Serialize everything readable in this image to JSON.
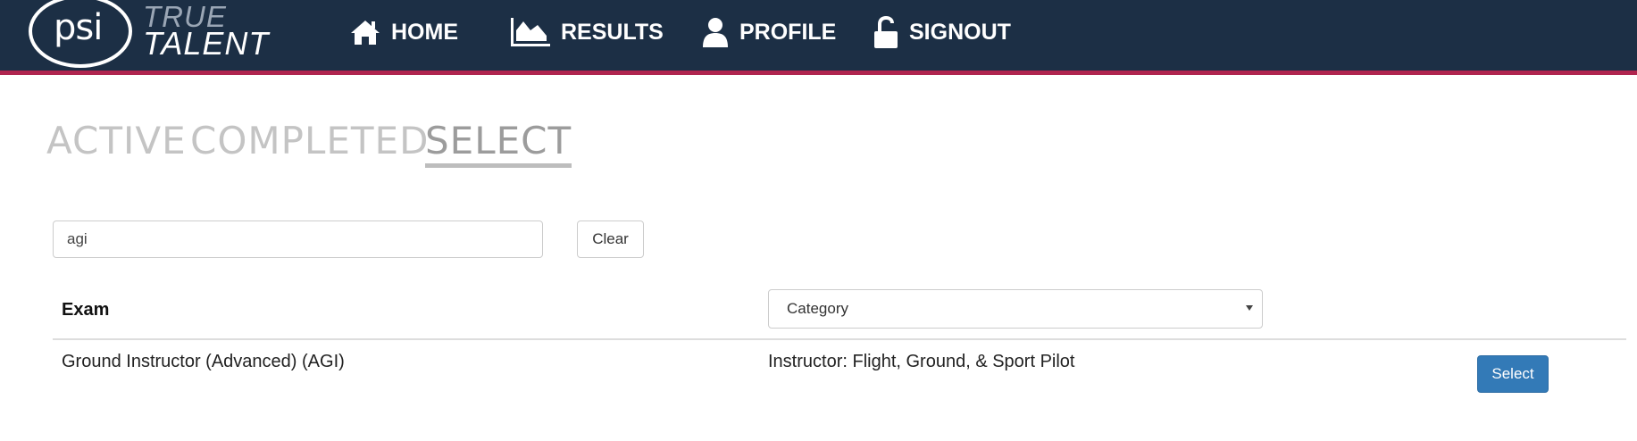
{
  "brand": {
    "psi": "psi",
    "true": "TRUE",
    "talent": "TALENT"
  },
  "nav": {
    "items": [
      {
        "label": "HOME",
        "icon": "home-icon"
      },
      {
        "label": "RESULTS",
        "icon": "chart-icon"
      },
      {
        "label": "PROFILE",
        "icon": "user-icon"
      },
      {
        "label": "SIGNOUT",
        "icon": "unlock-icon"
      }
    ]
  },
  "tabs": {
    "items": [
      {
        "label": "ACTIVE"
      },
      {
        "label": "COMPLETED"
      },
      {
        "label": "SELECT"
      }
    ],
    "active": "SELECT"
  },
  "search": {
    "value": "agi",
    "clear_label": "Clear"
  },
  "table": {
    "headers": {
      "exam": "Exam",
      "category_select": "Category"
    },
    "rows": [
      {
        "exam": "Ground Instructor (Advanced) (AGI)",
        "category": "Instructor: Flight, Ground, & Sport Pilot",
        "action": "Select"
      }
    ]
  },
  "colors": {
    "navbar": "#1c2f45",
    "navbar_accent": "#b0254f",
    "primary_button": "#337ab7",
    "tab_inactive": "#c4c4c4",
    "tab_active": "#9c9c9c"
  }
}
